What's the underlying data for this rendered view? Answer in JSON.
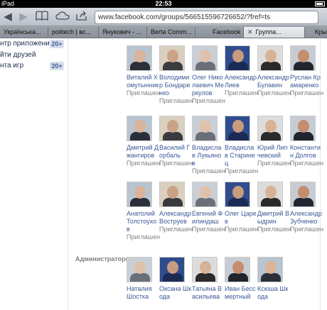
{
  "status": {
    "time": "22:53",
    "carrier": "iPad"
  },
  "browser": {
    "url": "www.facebook.com/groups/566515596726652/?fref=ts",
    "tabs": [
      "Українська...",
      "politech | вс...",
      "Янукович - ...",
      "Berta Comm...",
      "Facebook",
      "Группа...",
      "Кры"
    ]
  },
  "sidebar": {
    "items": [
      {
        "label": "нтр приложений",
        "badge": "20+"
      },
      {
        "label": "йти друзей",
        "badge": ""
      },
      {
        "label": "нта игр",
        "badge": "20+"
      }
    ]
  },
  "invite_label": "Приглашен",
  "members": [
    {
      "name": "Виталий Хомутынник"
    },
    {
      "name": "Володимир Бондаренко"
    },
    {
      "name": "Олег Николаевич Меркулов"
    },
    {
      "name": "Александр Лиев"
    },
    {
      "name": "Александр Булавин"
    },
    {
      "name": "Руслан Крамаренко"
    },
    {
      "name": "Дмитрий Джангиров"
    },
    {
      "name": "Василий Горбаль"
    },
    {
      "name": "Владислав Лукьянов"
    },
    {
      "name": "Владислав Старинец"
    },
    {
      "name": "Юрий Липчевский"
    },
    {
      "name": "Константин Долгов"
    },
    {
      "name": "Анатолий Толстоухов"
    },
    {
      "name": "Александр Воструев"
    },
    {
      "name": "Евгений Филиндаш"
    },
    {
      "name": "Олег Царев"
    },
    {
      "name": "Дмитрий Выдрин"
    },
    {
      "name": "Александр Зубченко"
    }
  ],
  "admins_section": "Администраторы",
  "admins": [
    {
      "name": "Наталия Шостка"
    },
    {
      "name": "Оксана Шкода"
    },
    {
      "name": "Татьяна Васильева"
    },
    {
      "name": "Иван Бессмертный"
    },
    {
      "name": "Ксюша Шкода"
    }
  ]
}
